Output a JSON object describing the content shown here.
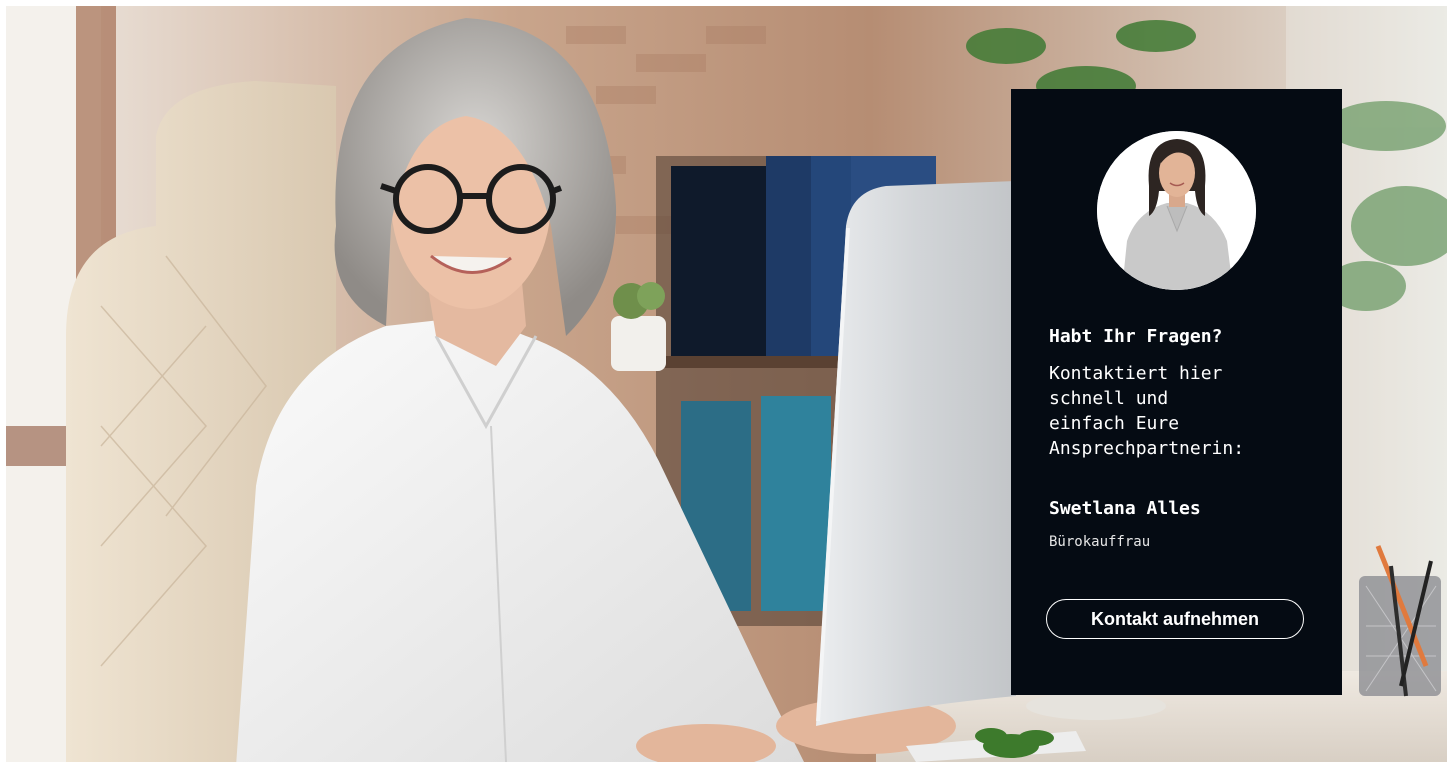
{
  "contact_card": {
    "heading": "Habt Ihr Fragen?",
    "text": "Kontaktiert hier\nschnell und\neinfach Eure\nAnsprechpartnerin:",
    "name": "Swetlana Alles",
    "role": "Bürokauffrau",
    "button_label": "Kontakt aufnehmen",
    "background_color": "#050b13",
    "text_color": "#ffffff"
  },
  "hero_image": {
    "icon": "office-woman-photo"
  },
  "avatar": {
    "icon": "contact-person-portrait"
  }
}
